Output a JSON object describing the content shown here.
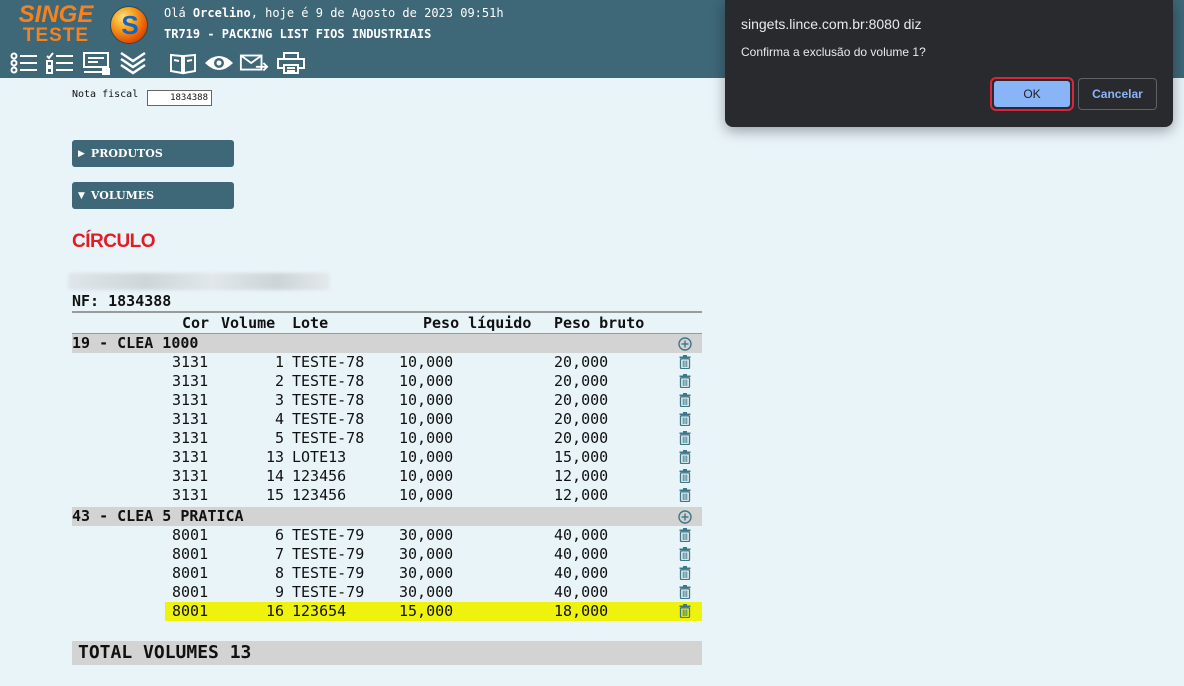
{
  "header": {
    "logo_line1": "SINGE",
    "logo_line2": "TESTE",
    "logo_ball_letter": "S",
    "greeting_prefix": "Olá",
    "user_name": "Orcelino",
    "greeting_suffix": ", hoje é 9 de Agosto de 2023 09:51h",
    "screen_title": "TR719 - PACKING LIST FIOS INDUSTRIAIS"
  },
  "toolbar": {
    "icons": [
      "list-icon",
      "checklist-icon",
      "form-icon",
      "chevrons-down-icon",
      "book-icon",
      "eye-icon",
      "mail-forward-icon",
      "printer-icon"
    ]
  },
  "form": {
    "nota_fiscal_label": "Nota fiscal",
    "nota_fiscal_value": "1834388"
  },
  "sections": {
    "produtos": {
      "arrow": "▶",
      "label": "PRODUTOS"
    },
    "volumes": {
      "arrow": "▼",
      "label": "VOLUMES"
    }
  },
  "brand": "CÍRCULO",
  "nf_heading": "NF: 1834388",
  "table": {
    "columns": [
      "Cor",
      "Volume",
      "Lote",
      "Peso líquido",
      "Peso bruto"
    ],
    "groups": [
      {
        "label": "19 - CLEA 1000",
        "rows": [
          {
            "cor": "3131",
            "volume": "1",
            "lote": "TESTE-78",
            "peso_liquido": "10,000",
            "peso_bruto": "20,000"
          },
          {
            "cor": "3131",
            "volume": "2",
            "lote": "TESTE-78",
            "peso_liquido": "10,000",
            "peso_bruto": "20,000"
          },
          {
            "cor": "3131",
            "volume": "3",
            "lote": "TESTE-78",
            "peso_liquido": "10,000",
            "peso_bruto": "20,000"
          },
          {
            "cor": "3131",
            "volume": "4",
            "lote": "TESTE-78",
            "peso_liquido": "10,000",
            "peso_bruto": "20,000"
          },
          {
            "cor": "3131",
            "volume": "5",
            "lote": "TESTE-78",
            "peso_liquido": "10,000",
            "peso_bruto": "20,000"
          },
          {
            "cor": "3131",
            "volume": "13",
            "lote": "LOTE13",
            "peso_liquido": "10,000",
            "peso_bruto": "15,000"
          },
          {
            "cor": "3131",
            "volume": "14",
            "lote": "123456",
            "peso_liquido": "10,000",
            "peso_bruto": "12,000"
          },
          {
            "cor": "3131",
            "volume": "15",
            "lote": "123456",
            "peso_liquido": "10,000",
            "peso_bruto": "12,000"
          }
        ]
      },
      {
        "label": "43 - CLEA 5 PRATICA",
        "rows": [
          {
            "cor": "8001",
            "volume": "6",
            "lote": "TESTE-79",
            "peso_liquido": "30,000",
            "peso_bruto": "40,000"
          },
          {
            "cor": "8001",
            "volume": "7",
            "lote": "TESTE-79",
            "peso_liquido": "30,000",
            "peso_bruto": "40,000"
          },
          {
            "cor": "8001",
            "volume": "8",
            "lote": "TESTE-79",
            "peso_liquido": "30,000",
            "peso_bruto": "40,000"
          },
          {
            "cor": "8001",
            "volume": "9",
            "lote": "TESTE-79",
            "peso_liquido": "30,000",
            "peso_bruto": "40,000"
          },
          {
            "cor": "8001",
            "volume": "16",
            "lote": "123654",
            "peso_liquido": "15,000",
            "peso_bruto": "18,000",
            "highlighted": true
          }
        ]
      }
    ],
    "total_label": "TOTAL VOLUMES 13"
  },
  "dialog": {
    "title": "singets.lince.com.br:8080 diz",
    "message": "Confirma a exclusão do volume 1?",
    "ok_label": "OK",
    "cancel_label": "Cancelar"
  },
  "colors": {
    "header_bg": "#3e6778",
    "page_bg": "#e9f4f9",
    "logo_orange": "#f58220",
    "brand_red": "#e31b23",
    "group_bg": "#d3d3d3",
    "highlight": "#eef20d",
    "icon_teal": "#3e7787",
    "dialog_bg": "#292a2d",
    "dialog_button": "#8ab4f8"
  }
}
